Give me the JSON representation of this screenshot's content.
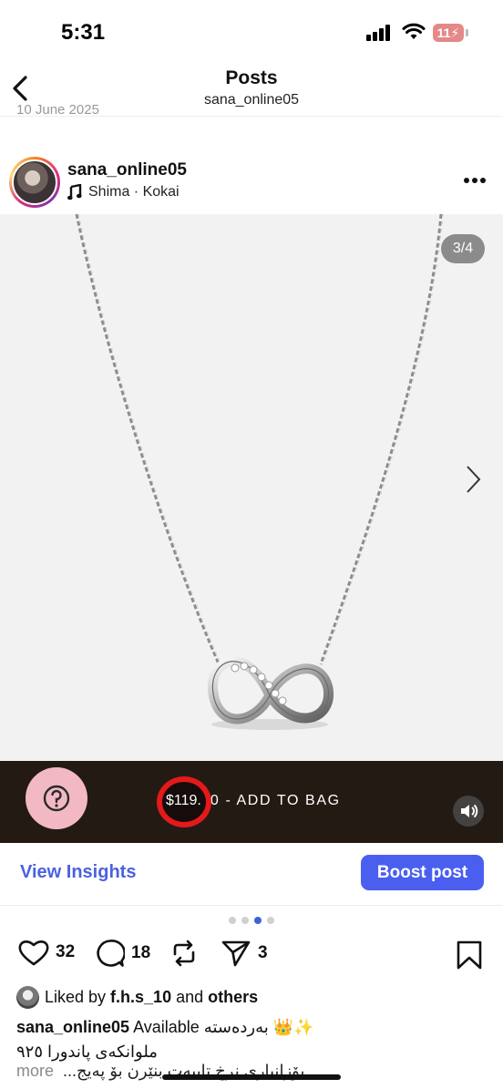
{
  "status_bar": {
    "time": "5:31",
    "battery": "11"
  },
  "header": {
    "title": "Posts",
    "subtitle": "sana_online05",
    "cut_off_date": "10 June 2025"
  },
  "post": {
    "username": "sana_online05",
    "audio": "Shima · Kokai",
    "image_counter": "3/4",
    "carousel": {
      "total": 4,
      "active_index": 2
    }
  },
  "shop_bar": {
    "price_visible": "$119.",
    "label": "0 - ADD TO BAG"
  },
  "insights": {
    "view_label": "View Insights",
    "boost_label": "Boost post"
  },
  "actions": {
    "likes": "32",
    "comments": "18",
    "shares": "3"
  },
  "caption": {
    "liked_prefix": "Liked by ",
    "liked_user": "f.h.s_10",
    "liked_mid": " and ",
    "liked_others": "others",
    "author": "sana_online05",
    "line1_text": " Available بەردەستە 👑✨",
    "line2": "ملوانکەی پاندورا ٩٢٥",
    "line3_rtl": "بۆزانیاری نرخ تایبەت بنێرن بۆ پەیج...",
    "more": "more"
  },
  "colors": {
    "accent_blue": "#4a5ff0",
    "insights_blue": "#4a62e0",
    "bag_bar": "#231a14",
    "help_pink": "#f2b9c4",
    "annotation_red": "#e3191b"
  },
  "icons": [
    "back-chevron-icon",
    "music-note-icon",
    "more-dots-icon",
    "next-chevron-icon",
    "help-question-icon",
    "volume-icon",
    "heart-icon",
    "comment-icon",
    "repost-icon",
    "send-icon",
    "bookmark-icon"
  ]
}
